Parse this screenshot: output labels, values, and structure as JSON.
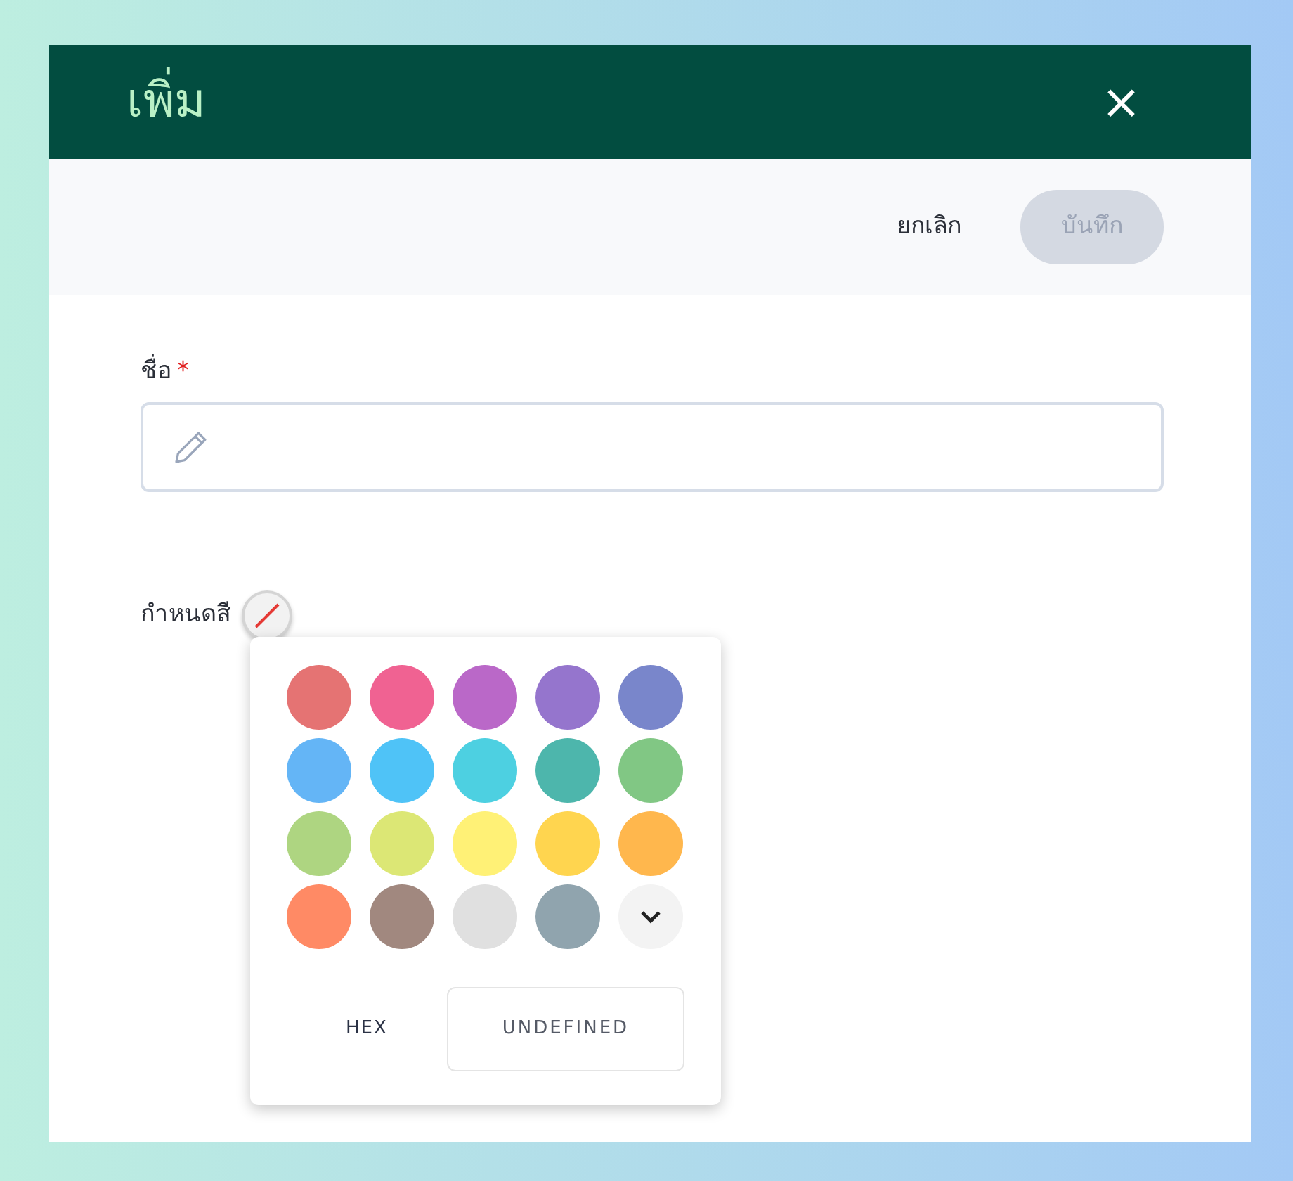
{
  "dialog": {
    "title": "เพิ่ม",
    "close": "×"
  },
  "toolbar": {
    "cancel": "ยกเลิก",
    "save": {
      "label": "บันทึก",
      "disabled": true
    }
  },
  "form": {
    "name_label": "ชื่อ",
    "required_mark": "*",
    "color_label": "กำหนดสี"
  },
  "color_picker": {
    "swatches": [
      {
        "color": "#e57373",
        "selected": false
      },
      {
        "color": "#f06292",
        "selected": false
      },
      {
        "color": "#ba68c8",
        "selected": false
      },
      {
        "color": "#9575cd",
        "selected": false
      },
      {
        "color": "#7986cb",
        "selected": false
      },
      {
        "color": "#64b5f6",
        "selected": false
      },
      {
        "color": "#4fc3f7",
        "selected": false
      },
      {
        "color": "#4dd0e1",
        "selected": false
      },
      {
        "color": "#4db6ac",
        "selected": false
      },
      {
        "color": "#81c784",
        "selected": false
      },
      {
        "color": "#aed581",
        "selected": false
      },
      {
        "color": "#dce775",
        "selected": false
      },
      {
        "color": "#fff176",
        "selected": false
      },
      {
        "color": "#ffd54f",
        "selected": false
      },
      {
        "color": "#ffb74d",
        "selected": false
      },
      {
        "color": "#ff8a65",
        "selected": false
      },
      {
        "color": "#a1887f",
        "selected": false
      },
      {
        "color": "#e0e0e0",
        "selected": false
      },
      {
        "color": "#90a4ae",
        "selected": false
      }
    ],
    "hex_label": "HEX",
    "hex_value": "UNDEFINED"
  }
}
